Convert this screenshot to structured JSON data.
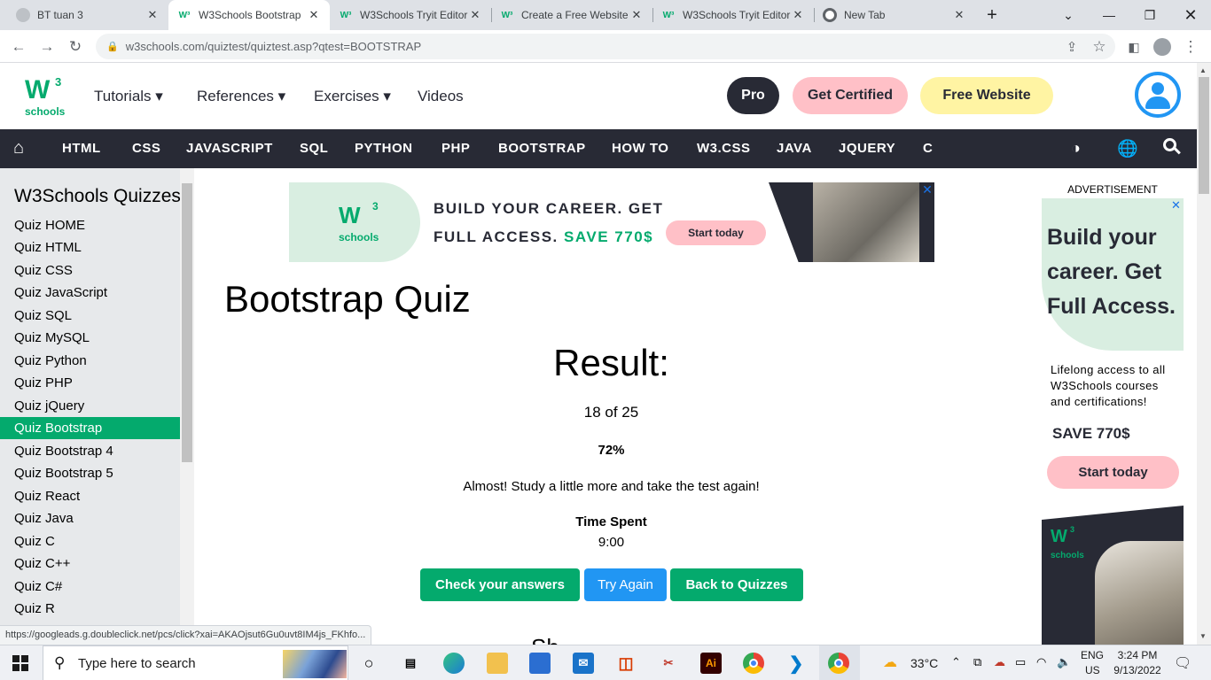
{
  "browser": {
    "tabs": [
      {
        "title": "BT tuan 3",
        "favicon": "generic-favicon"
      },
      {
        "title": "W3Schools Bootstrap",
        "favicon": "w3-favicon"
      },
      {
        "title": "W3Schools Tryit Editor",
        "favicon": "w3-favicon"
      },
      {
        "title": "Create a Free Website",
        "favicon": "w3-favicon"
      },
      {
        "title": "W3Schools Tryit Editor",
        "favicon": "w3-favicon"
      },
      {
        "title": "New Tab",
        "favicon": "chrome-favicon"
      }
    ],
    "new_tab_symbol": "+",
    "url": "w3schools.com/quiztest/quiztest.asp?qtest=BOOTSTRAP",
    "status_url": "https://googleads.g.doubleclick.net/pcs/click?xai=AKAOjsut6Gu0uvt8IM4js_FKhfo..."
  },
  "header": {
    "logo_w": "W",
    "logo_sup": "3",
    "logo_text": "schools",
    "menu": [
      "Tutorials",
      "References",
      "Exercises",
      "Videos"
    ],
    "pro": "Pro",
    "get_certified": "Get Certified",
    "free_website": "Free Website"
  },
  "topnav": {
    "links": [
      "HTML",
      "CSS",
      "JAVASCRIPT",
      "SQL",
      "PYTHON",
      "PHP",
      "BOOTSTRAP",
      "HOW TO",
      "W3.CSS",
      "JAVA",
      "JQUERY",
      "C"
    ]
  },
  "sidebar": {
    "title": "W3Schools Quizzes",
    "items": [
      "Quiz HOME",
      "Quiz HTML",
      "Quiz CSS",
      "Quiz JavaScript",
      "Quiz SQL",
      "Quiz MySQL",
      "Quiz Python",
      "Quiz PHP",
      "Quiz jQuery",
      "Quiz Bootstrap",
      "Quiz Bootstrap 4",
      "Quiz Bootstrap 5",
      "Quiz React",
      "Quiz Java",
      "Quiz C",
      "Quiz C++",
      "Quiz C#",
      "Quiz R"
    ],
    "active_index": 9
  },
  "banner_ad": {
    "line1": "BUILD YOUR CAREER. GET",
    "line2_prefix": "FULL ACCESS.",
    "line2_accent": "SAVE 770$",
    "cta": "Start today",
    "logo_text": "schools"
  },
  "main": {
    "heading": "Bootstrap Quiz",
    "result_title": "Result:",
    "score": "18 of 25",
    "percent": "72%",
    "message": "Almost! Study a little more and take the test again!",
    "time_label": "Time Spent",
    "time_value": "9:00",
    "buttons": {
      "check": "Check your answers",
      "try_again": "Try Again",
      "back": "Back to Quizzes"
    },
    "partial_text": "Sh"
  },
  "right_ad": {
    "label": "ADVERTISEMENT",
    "headline_1": "Build your",
    "headline_2": "career. Get",
    "headline_3": "Full Access.",
    "body_1": "Lifelong access to all",
    "body_2": "W3Schools courses",
    "body_3": "and certifications!",
    "save": "SAVE 770$",
    "cta": "Start today",
    "logo_text": "schools"
  },
  "taskbar": {
    "search_placeholder": "Type here to search",
    "weather": "33°C",
    "lang_1": "ENG",
    "lang_2": "US",
    "time": "3:24 PM",
    "date": "9/13/2022",
    "ai_label": "Ai"
  },
  "colors": {
    "w3_green": "#04aa6d",
    "nav_dark": "#282a35",
    "pink": "#ffc0c7",
    "yellow": "#fff4a3",
    "blue": "#2196f3"
  }
}
